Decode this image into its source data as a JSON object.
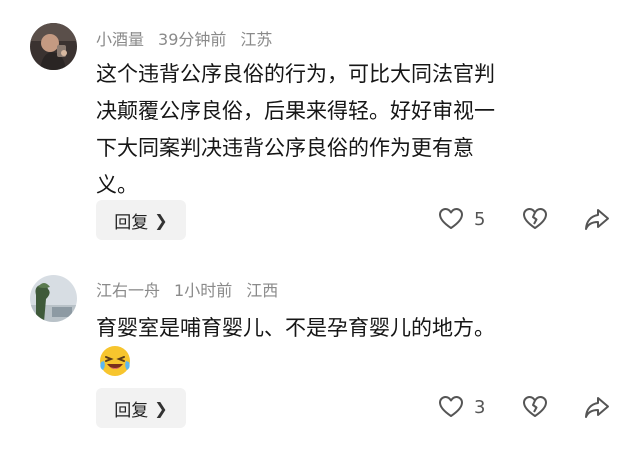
{
  "comments": [
    {
      "username": "小酒量",
      "time": "39分钟前",
      "location": "江苏",
      "lines": [
        "这个违背公序良俗的行为，可比大同法官判",
        "决颠覆公序良俗，后果来得轻。好好审视一",
        "下大同案判决违背公序良俗的作为更有意",
        "义。"
      ],
      "reply_label": "回复",
      "like_count": "5",
      "avatar_icon": "user-avatar-dark",
      "like_icon": "heart-outline-icon",
      "dislike_icon": "broken-heart-outline-icon",
      "share_icon": "share-arrow-icon"
    },
    {
      "username": "江右一舟",
      "time": "1小时前",
      "location": "江西",
      "lines": [
        "育婴室是哺育婴儿、不是孕育婴儿的地方。"
      ],
      "emoji": "laughing-crying-emoji",
      "reply_label": "回复",
      "like_count": "3",
      "avatar_icon": "user-avatar-landscape",
      "like_icon": "heart-outline-icon",
      "dislike_icon": "broken-heart-outline-icon",
      "share_icon": "share-arrow-icon"
    }
  ],
  "colors": {
    "meta_text": "#8a8a8a",
    "body_text": "#161616",
    "button_bg": "#f2f2f2",
    "icon_stroke": "#555555"
  }
}
